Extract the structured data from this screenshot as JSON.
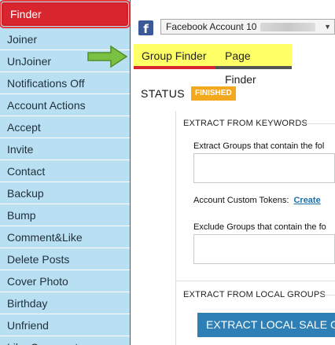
{
  "sidebar": {
    "items": [
      {
        "label": "Finder",
        "active": true
      },
      {
        "label": "Joiner"
      },
      {
        "label": "UnJoiner"
      },
      {
        "label": "Notifications Off"
      },
      {
        "label": "Account Actions"
      },
      {
        "label": "Accept"
      },
      {
        "label": "Invite"
      },
      {
        "label": "Contact"
      },
      {
        "label": "Backup"
      },
      {
        "label": "Bump"
      },
      {
        "label": "Comment&Like"
      },
      {
        "label": "Delete Posts"
      },
      {
        "label": "Cover Photo"
      },
      {
        "label": "Birthday"
      },
      {
        "label": "Unfriend"
      },
      {
        "label": "Like Comments"
      }
    ]
  },
  "account": {
    "icon": "facebook-icon",
    "icon_glyph": "f",
    "selected": "Facebook Account 10"
  },
  "tabs": [
    {
      "label": "Group Finder"
    },
    {
      "label": "Page Finder"
    }
  ],
  "status": {
    "label": "STATUS",
    "badge": "FINISHED",
    "badge_color": "#f4a81d"
  },
  "keywords_section": {
    "title": "EXTRACT FROM KEYWORDS",
    "contain_label": "Extract Groups that contain the fol",
    "tokens_label": "Account Custom Tokens:",
    "tokens_link": "Create",
    "exclude_label": "Exclude Groups that contain the fo"
  },
  "local_section": {
    "title": "EXTRACT FROM LOCAL GROUPS",
    "button_label": "EXTRACT LOCAL SALE GR"
  },
  "colors": {
    "sidebar_bg": "#b9dff2",
    "active_item": "#d9262e",
    "tab_bg": "#ffff66",
    "button_bg": "#2d7fb5",
    "arrow": "#7ac143"
  }
}
